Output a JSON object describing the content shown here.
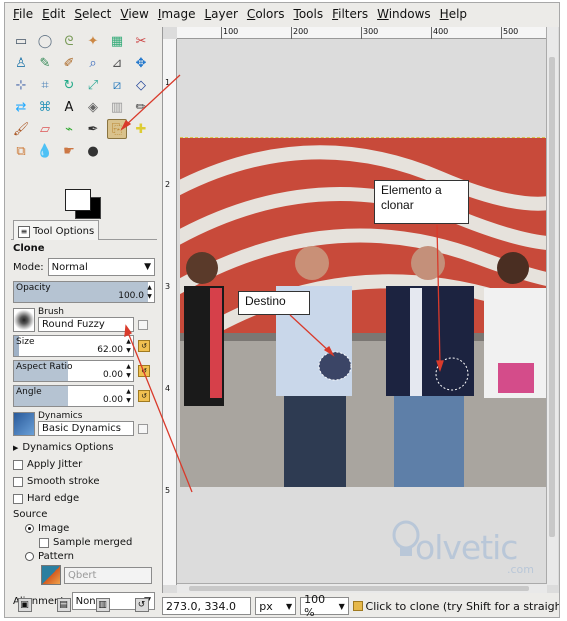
{
  "menubar": [
    "File",
    "Edit",
    "Select",
    "View",
    "Image",
    "Layer",
    "Colors",
    "Tools",
    "Filters",
    "Windows",
    "Help"
  ],
  "toolbox": {
    "tools": [
      "rect-select-icon",
      "ellipse-select-icon",
      "free-select-icon",
      "fuzzy-select-icon",
      "select-by-color-icon",
      "scissors-select-icon",
      "foreground-select-icon",
      "paths-icon",
      "color-picker-icon",
      "zoom-icon",
      "measure-icon",
      "move-icon",
      "align-icon",
      "crop-icon",
      "rotate-icon",
      "scale-icon",
      "shear-icon",
      "perspective-icon",
      "flip-icon",
      "cage-icon",
      "text-icon",
      "bucket-fill-icon",
      "blend-icon",
      "pencil-icon",
      "paintbrush-icon",
      "eraser-icon",
      "airbrush-icon",
      "ink-icon",
      "clone-icon",
      "heal-icon",
      "perspective-clone-icon",
      "blur-icon",
      "smudge-icon",
      "dodge-burn-icon"
    ],
    "selected_tool": "clone-icon"
  },
  "tool_options": {
    "tab_label": "Tool Options",
    "title": "Clone",
    "mode_label": "Mode:",
    "mode_value": "Normal",
    "opacity": {
      "label": "Opacity",
      "value": "100.0"
    },
    "brush_label": "Brush",
    "brush_value": "Round Fuzzy",
    "size": {
      "label": "Size",
      "value": "62.00"
    },
    "aspect_ratio": {
      "label": "Aspect Ratio",
      "value": "0.00"
    },
    "angle": {
      "label": "Angle",
      "value": "0.00"
    },
    "dynamics_label": "Dynamics",
    "dynamics_value": "Basic Dynamics",
    "dynamics_options_label": "Dynamics Options",
    "apply_jitter": "Apply Jitter",
    "smooth_stroke": "Smooth stroke",
    "hard_edge": "Hard edge",
    "source_label": "Source",
    "source_image": "Image",
    "sample_merged": "Sample merged",
    "source_pattern": "Pattern",
    "pattern_value": "Qbert",
    "alignment_label": "Alignment:",
    "alignment_value": "None"
  },
  "ruler": {
    "ticks": [
      "100",
      "200",
      "300",
      "400",
      "500"
    ]
  },
  "vruler_labels": [
    "1",
    "2",
    "3",
    "4",
    "5"
  ],
  "status": {
    "coords": "273.0, 334.0",
    "unit": "px",
    "zoom": "100 %",
    "message": "Click to clone (try Shift for a straight lin..."
  },
  "annotations": {
    "elemento": "Elemento a clonar",
    "destino": "Destino"
  },
  "watermark": {
    "word": "olvetic",
    "domain": ".com"
  },
  "colors": {
    "accent": "#d93a2b",
    "selected_tool_bg": "#d9c28c"
  }
}
